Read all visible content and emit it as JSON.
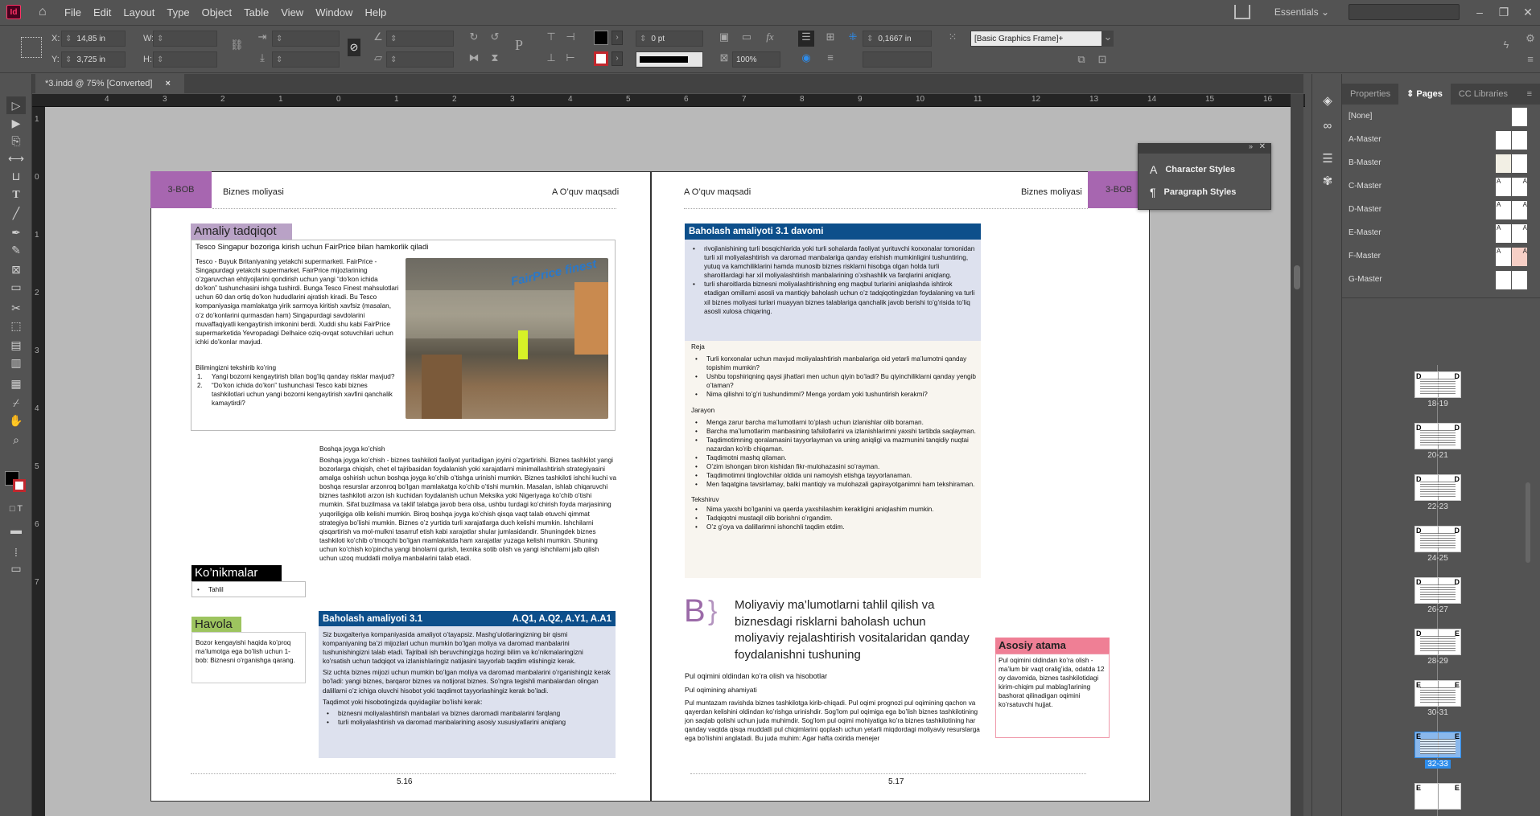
{
  "app": {
    "icon_label": "Id",
    "title": "Adobe InDesign"
  },
  "menu": [
    "File",
    "Edit",
    "Layout",
    "Type",
    "Object",
    "Table",
    "View",
    "Window",
    "Help"
  ],
  "top_right": {
    "workspace": "Essentials",
    "search_placeholder": ""
  },
  "control": {
    "x_label": "X:",
    "x_value": "14,85 in",
    "y_label": "Y:",
    "y_value": "3,725 in",
    "w_label": "W:",
    "w_value": "",
    "h_label": "H:",
    "h_value": "",
    "stroke_weight": "0 pt",
    "opacity": "100%",
    "inset": "0,1667 in",
    "object_style": "[Basic Graphics Frame]+"
  },
  "document_tab": {
    "title": "*3.indd @ 75% [Converted]",
    "close": "×"
  },
  "hruler": [
    "4",
    "3",
    "2",
    "1",
    "0",
    "1",
    "2",
    "3",
    "4",
    "5",
    "6",
    "7",
    "8",
    "9",
    "10",
    "11",
    "12",
    "13",
    "14",
    "15",
    "16"
  ],
  "vruler": [
    "1",
    "0",
    "1",
    "2",
    "3",
    "4",
    "5",
    "6",
    "7"
  ],
  "tools": [
    "selection",
    "direct-selection",
    "page",
    "gap",
    "content-collector",
    "type",
    "line",
    "pen",
    "pencil",
    "rectangle-frame",
    "rectangle",
    "scissors",
    "free-transform",
    "gradient-swatch",
    "gradient-feather",
    "note",
    "eyedropper",
    "hand",
    "zoom"
  ],
  "left_page": {
    "chapter": "3-BOB",
    "header_left": "Biznes moliyasi",
    "header_right": "A O’quv maqsadi",
    "case_study": {
      "label": "Amaliy tadqiqot",
      "title": "Tesco Singapur bozoriga kirish uchun FairPrice bilan hamkorlik qiladi",
      "body": "Tesco - Buyuk Britaniyaning yetakchi supermarketi. FairPrice - Singapurdagi yetakchi supermarket. FairPrice mijozlarining o’zgaruvchan ehtiyojlarini qondirish uchun yangi “do’kon ichida do’kon” tushunchasini ishga tushirdi. Bunga Tesco Finest mahsulotlari uchun 60 dan ortiq do’kon hududlarini ajratish kiradi. Bu Tesco kompaniyasiga mamlakatga yirik sarmoya kiritish xavfsiz (masalan, o’z do’konlarini qurmasdan ham) Singapurdagi savdolarini muvaffaqiyatli kengaytirish imkonini berdi. Xuddi shu kabi FairPrice supermarketida Yevropadagi Delhaice oziq-ovqat sotuvchilari uchun ichki do’konlar mavjud.",
      "check_title": "Bilimingizni tekshirib ko’ring",
      "questions": [
        "Yangi bozorni kengaytirish bilan bog’liq qanday risklar mavjud?",
        "“Do’kon ichida do’kon” tushunchasi Tesco kabi biznes tashkilotlari uchun yangi bozorni kengaytirish xavfini qanchalik kamaytirdi?"
      ],
      "image_alt": "FairPrice Finest store photo",
      "image_sign": "FairPrice finest"
    },
    "relocation": {
      "title": "Boshqa joyga ko’chish",
      "body": "Boshqa joyga ko’chish - biznes tashkiloti faoliyat yuritadigan joyini o’zgartirishi. Biznes tashkilot yangi bozorlarga chiqish, chet el tajribasidan foydalanish yoki xarajatlarni minimallashtirish strategiyasini amalga oshirish uchun boshqa joyga ko’chib o’tishga urinishi mumkin. Biznes tashkiloti ishchi kuchi va boshqa resurslar arzonroq bo’lgan mamlakatga ko’chib o’tishi mumkin. Masalan, ishlab chiqaruvchi biznes tashkiloti arzon ish kuchidan foydalanish uchun Meksika yoki Nigeriyaga ko’chib o’tishi mumkin. Sifat buzilmasa va taklif talabga javob bera olsa, ushbu turdagi ko’chirish foyda marjasining yuqoriligiga olib kelishi mumkin. Biroq boshqa joyga ko’chish qisqa vaqt talab etuvchi qimmat strategiya bo’lishi mumkin. Biznes o’z yurtida turli xarajatlarga duch kelishi mumkin. Ishchilarni qisqartirish va mol-mulkni tasarruf etish kabi xarajatlar shular jumlasidandir. Shuningdek biznes tashkiloti ko’chib o’tmoqchi bo’lgan mamlakatda ham xarajatlar yuzaga kelishi mumkin. Shuning uchun ko’chish ko’pincha yangi binolarni qurish, texnika sotib olish va yangi ishchilarni jalb qilish uchun uzoq muddatli moliya manbalarini talab etadi."
    },
    "skills": {
      "label": "Ko’nikmalar",
      "items": [
        "Tahlil"
      ]
    },
    "link": {
      "label": "Havola",
      "body": "Bozor kengayishi haqida ko’proq ma’lumotga ega bo’lish uchun 1-bob: Biznesni o’rganishga qarang."
    },
    "assessment": {
      "title": "Baholash amaliyoti 3.1",
      "codes": "A.Q1, A.Q2, A.Y1, A.A1",
      "p1": "Siz buxgalteriya kompaniyasida amaliyot o’tayapsiz. Mashg’ulotlaringizning bir qismi kompaniyaning ba’zi mijozlari uchun mumkin bo’lgan moliya va daromad manbalarini tushunishingizni talab etadi. Tajribali ish beruvchingizga hozirgi bilim va ko’nikmalaringizni ko’rsatish uchun tadqiqot va izlanishlaringiz natijasini tayyorlab taqdim etishingiz kerak.",
      "p2": "Siz uchta biznes mijozi uchun mumkin bo’lgan moliya va daromad manbalarini o’rganishingiz kerak bo’ladi: yangi biznes, barqaror biznes va notijorat biznes. So’ngra tegishli manbalardan olingan dalillarni o’z ichiga oluvchi hisobot yoki taqdimot tayyorlashingiz kerak bo’ladi.",
      "p3": "Taqdimot yoki hisobotingizda quyidagilar bo’lishi kerak:",
      "bullets": [
        "biznesni moliyalashtirish manbalari va biznes daromadi manbalarini farqlang",
        "turli moliyalashtirish va daromad manbalarining asosiy xususiyatlarini aniqlang"
      ]
    },
    "page_number": "5.16"
  },
  "right_page": {
    "chapter": "3-BOB",
    "header_left": "A O’quv maqsadi",
    "header_right": "Biznes moliyasi",
    "assessment_cont": {
      "title": "Baholash amaliyoti 3.1 davomi",
      "bullets": [
        "rivojlanishining turli bosqichlarida yoki turli sohalarda faoliyat yurituvchi korxonalar tomonidan turli xil moliyalashtirish va daromad manbalariga qanday erishish mumkinligini tushuntiring, yutuq va kamchiliklarini hamda munosib biznes risklarni hisobga olgan holda turli sharoitlardagi har xil moliyalashtirish manbalarining o’xshashlik va farqlarini aniqlang.",
        "turli sharoitlarda biznesni moliyalashtirishning eng maqbul turlarini aniqlashda ishtirok etadigan omillarni asosli va mantiqiy baholash uchun o’z tadqiqotingizdan foydalaning va turli xil biznes moliyasi turlari muayyan biznes talablariga qanchalik javob berishi to’g’risida to’liq asosli xulosa chiqaring."
      ],
      "plan_title": "Reja",
      "plan": [
        "Turli korxonalar uchun mavjud moliyalashtirish manbalariga oid yetarli ma’lumotni qanday topishim mumkin?",
        "Ushbu topshiriqning qaysi jihatlari men uchun qiyin bo’ladi? Bu qiyinchiliklarni qanday yengib o’taman?",
        "Nima qilishni to’g’ri tushundimmi? Menga yordam yoki tushuntirish kerakmi?"
      ],
      "process_title": "Jarayon",
      "process": [
        "Menga zarur barcha ma’lumotlarni to’plash uchun izlanishlar olib boraman.",
        "Barcha ma’lumotlarim manbasining tafsilotlarini va izlanishlarimni yaxshi tartibda saqlayman.",
        "Taqdimotimning qoralamasini tayyorlayman va uning aniqligi va mazmunini tanqidiy nuqtai nazardan ko’rib chiqaman.",
        "Taqdimotni mashq qilaman.",
        "O’zim ishongan biron kishidan fikr-mulohazasini so’rayman.",
        "Taqdimotimni tinglovchilar oldida uni namoyish etishga tayyorlanaman.",
        "Men faqatgina tavsirlamay, balki mantiqiy va mulohazali gapirayotganimni ham tekshiraman."
      ],
      "review_title": "Tekshiruv",
      "review": [
        "Nima yaxshi bo’lganini va qaerda yaxshilashim kerakligini aniqlashim mumkin.",
        "Tadqiqotni mustaqil olib borishni o’rgandim.",
        "O’z g’oya va dalillarimni ishonchli taqdim etdim."
      ]
    },
    "section": {
      "letter": "B",
      "brace": "}",
      "heading": "Moliyaviy ma’lumotlarni tahlil qilish va biznesdagi risklarni baholash uchun moliyaviy rejalashtirish vositalaridan qanday foydalanishni tushuning",
      "sub1": "Pul oqimini oldindan ko’ra olish va hisobotlar",
      "sub2": "Pul oqimining ahamiyati",
      "body": "Pul muntazam ravishda biznes tashkilotga kirib-chiqadi. Pul oqimi prognozi pul oqimining qachon va qayerdan kelishini oldindan ko’rishga urinishdir. Sog’lom pul oqimiga ega bo’lish biznes tashkilotining jon saqlab qolishi uchun juda muhimdir. Sog’lom pul oqimi mohiyatiga ko’ra biznes tashkilotining har qanday vaqtda qisqa muddatli pul chiqimlarini qoplash uchun yetarli miqdordagi moliyaviy resurslarga ega bo’lishini anglatadi. Bu juda muhim: Agar hafta oxirida menejer"
    },
    "key_term": {
      "label": "Asosiy atama",
      "body": "Pul oqimini oldindan ko’ra olish - ma’lum bir vaqt oralig’ida, odatda 12 oy davomida, biznes tashkilotidagi kirim-chiqim pul mablag’larining bashorat qilinadigan oqimini ko’rsatuvchi hujjat."
    },
    "page_number": "5.17"
  },
  "float_panel": {
    "items": [
      "Character Styles",
      "Paragraph Styles"
    ]
  },
  "right_panel": {
    "tabs": [
      "Properties",
      "Pages",
      "CC Libraries"
    ],
    "active_tab": "Pages",
    "masters": [
      "[None]",
      "A-Master",
      "B-Master",
      "C-Master",
      "D-Master",
      "E-Master",
      "F-Master",
      "G-Master"
    ],
    "spreads": [
      {
        "label": "18-19",
        "left": "D",
        "right": "D"
      },
      {
        "label": "20-21",
        "left": "D",
        "right": "D"
      },
      {
        "label": "22-23",
        "left": "D",
        "right": "D"
      },
      {
        "label": "24-25",
        "left": "D",
        "right": "D"
      },
      {
        "label": "26-27",
        "left": "D",
        "right": "D"
      },
      {
        "label": "28-29",
        "left": "D",
        "right": "E"
      },
      {
        "label": "30-31",
        "left": "E",
        "right": "E"
      },
      {
        "label": "32-33",
        "left": "E",
        "right": "E",
        "selected": true
      },
      {
        "label": "",
        "left": "E",
        "right": "E"
      }
    ]
  },
  "colors": {
    "chapter_purple": "#a766b0",
    "assessment_blue": "#0d4f8b",
    "assessment_bg": "#dde1ee",
    "plan_bg": "#f8f5ef",
    "skills_black": "#000000",
    "link_green": "#9dc45f",
    "keyterm_pink": "#ef7f95",
    "selected_blue": "#2d8ceb"
  }
}
